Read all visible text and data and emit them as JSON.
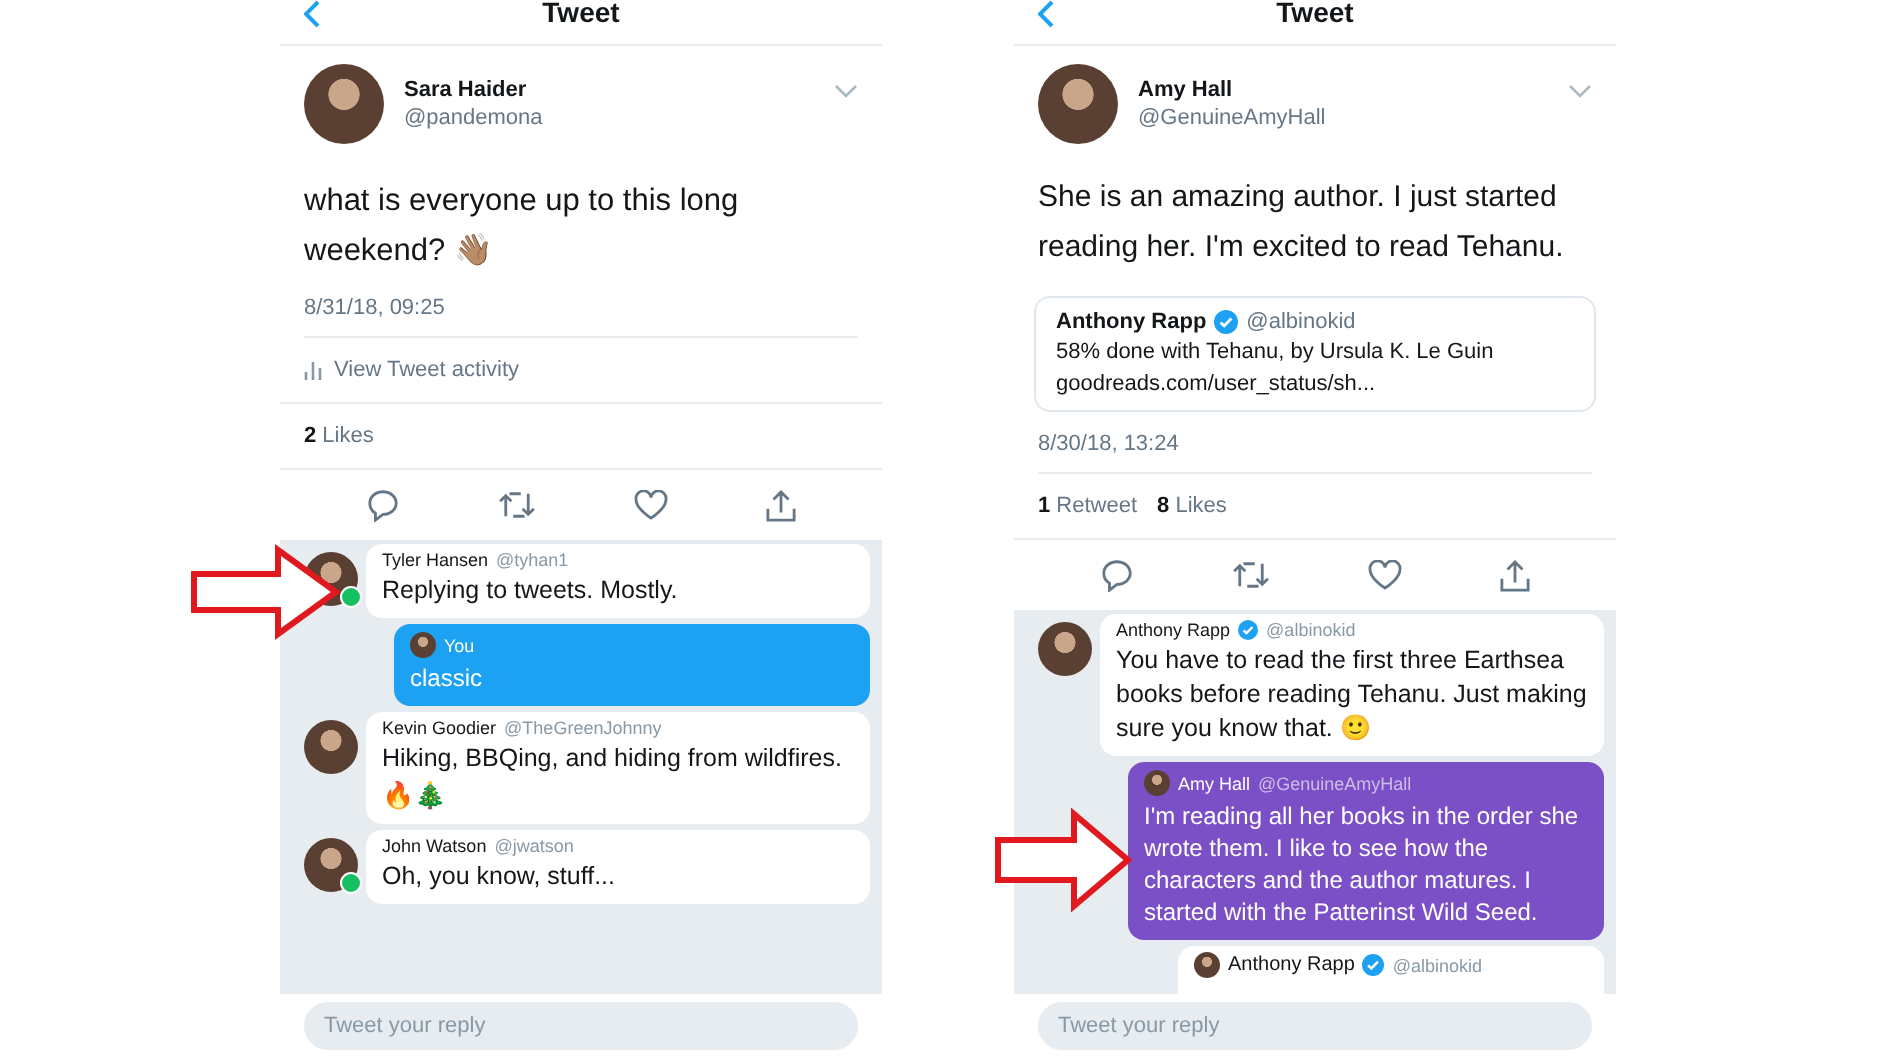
{
  "panels": [
    {
      "title": "Tweet",
      "author": {
        "name": "Sara Haider",
        "handle": "@pandemona"
      },
      "text": "what is everyone up to this long weekend? 👋🏽",
      "timestamp": "8/31/18, 09:25",
      "activity": "View Tweet activity",
      "stats": [
        {
          "count": "2",
          "label": "Likes"
        }
      ],
      "replies": [
        {
          "kind": "incoming",
          "name": "Tyler Hansen",
          "handle": "@tyhan1",
          "online": true,
          "text": "Replying to tweets. Mostly."
        },
        {
          "kind": "outgoing",
          "name": "You",
          "color": "#1da1f2",
          "text": "classic"
        },
        {
          "kind": "incoming",
          "name": "Kevin Goodier",
          "handle": "@TheGreenJohnny",
          "text": "Hiking, BBQing, and hiding from wildfires.",
          "extra": "🔥🎄"
        },
        {
          "kind": "incoming",
          "name": "John Watson",
          "handle": "@jwatson",
          "online": true,
          "text": "Oh, you know, stuff..."
        }
      ],
      "placeholder": "Tweet your reply"
    },
    {
      "title": "Tweet",
      "author": {
        "name": "Amy Hall",
        "handle": "@GenuineAmyHall"
      },
      "text": "She is an amazing author. I just started reading her.  I'm excited to read Tehanu.",
      "quote": {
        "name": "Anthony Rapp",
        "handle": "@albinokid",
        "verified": true,
        "text": "58% done with Tehanu, by Ursula K. Le Guin",
        "link": "goodreads.com/user_status/sh..."
      },
      "timestamp": "8/30/18, 13:24",
      "stats": [
        {
          "count": "1",
          "label": "Retweet"
        },
        {
          "count": "8",
          "label": "Likes"
        }
      ],
      "replies": [
        {
          "kind": "incoming",
          "name": "Anthony Rapp",
          "handle": "@albinokid",
          "verified": true,
          "text": "You have to read the first three Earthsea books before reading Tehanu. Just making sure you know that. 🙂"
        },
        {
          "kind": "outgoing",
          "name": "Amy Hall",
          "handle": "@GenuineAmyHall",
          "color": "#7b4fc6",
          "text": "I'm reading all her books in the order she wrote them.  I like to see how the characters and the author matures.  I started with the Patterinst Wild Seed."
        },
        {
          "kind": "nested",
          "name": "Anthony Rapp",
          "handle": "@albinokid",
          "verified": true
        }
      ],
      "placeholder": "Tweet your reply"
    }
  ]
}
